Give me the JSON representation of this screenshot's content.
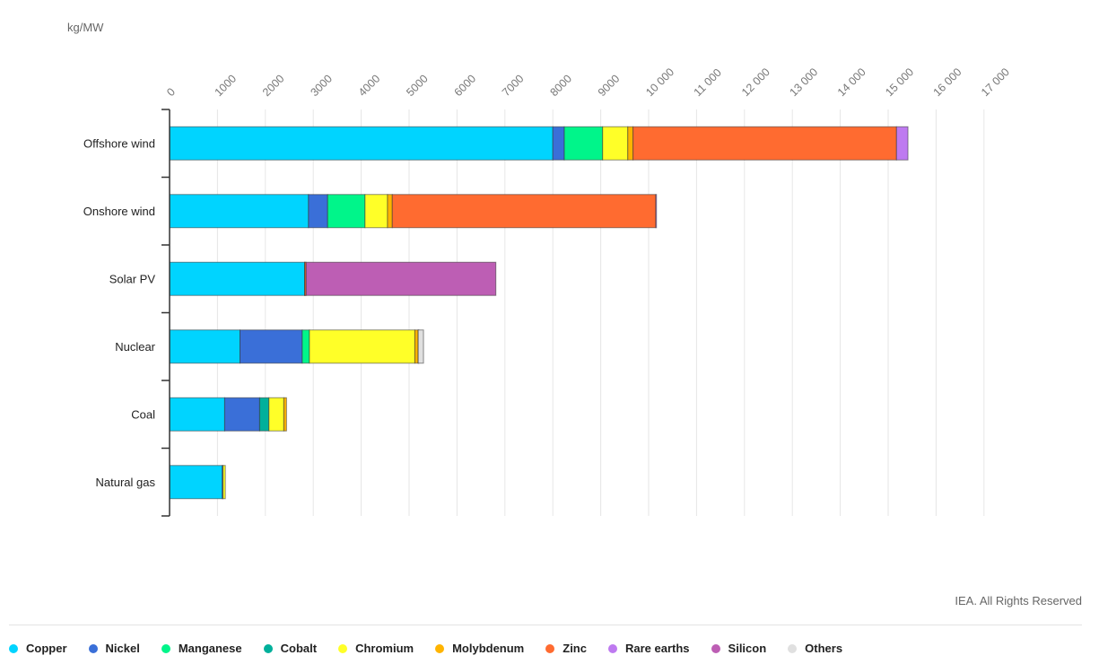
{
  "chart_data": {
    "type": "bar",
    "orientation": "horizontal",
    "stacked": true,
    "title": "",
    "unit_label": "kg/MW",
    "xlabel": "",
    "ylabel": "",
    "xlim": [
      0,
      17000
    ],
    "x_ticks": [
      0,
      1000,
      2000,
      3000,
      4000,
      5000,
      6000,
      7000,
      8000,
      9000,
      10000,
      11000,
      12000,
      13000,
      14000,
      15000,
      16000,
      17000
    ],
    "x_tick_labels": [
      "0",
      "1000",
      "2000",
      "3000",
      "4000",
      "5000",
      "6000",
      "7000",
      "8000",
      "9000",
      "10 000",
      "11 000",
      "12 000",
      "13 000",
      "14 000",
      "15 000",
      "16 000",
      "17 000"
    ],
    "grid": true,
    "legend_position": "bottom",
    "categories": [
      "Offshore wind",
      "Onshore wind",
      "Solar PV",
      "Nuclear",
      "Coal",
      "Natural gas"
    ],
    "series": [
      {
        "name": "Copper",
        "color": "#00d4ff",
        "values": [
          8000,
          2900,
          2820,
          1470,
          1150,
          1100
        ]
      },
      {
        "name": "Nickel",
        "color": "#3a6fd8",
        "values": [
          240,
          400,
          1,
          1300,
          730,
          16
        ]
      },
      {
        "name": "Manganese",
        "color": "#00f58a",
        "values": [
          800,
          780,
          0,
          150,
          0,
          0
        ]
      },
      {
        "name": "Cobalt",
        "color": "#00b09b",
        "values": [
          0,
          0,
          0,
          0,
          195,
          0
        ]
      },
      {
        "name": "Chromium",
        "color": "#ffff28",
        "values": [
          525,
          470,
          0,
          2200,
          310,
          48
        ]
      },
      {
        "name": "Molybdenum",
        "color": "#ffb400",
        "values": [
          109,
          99,
          0,
          70,
          56,
          0
        ]
      },
      {
        "name": "Zinc",
        "color": "#ff6b30",
        "values": [
          5500,
          5500,
          30,
          0,
          0,
          0
        ]
      },
      {
        "name": "Rare earths",
        "color": "#be7af0",
        "values": [
          239,
          14,
          0,
          0.5,
          0,
          0
        ]
      },
      {
        "name": "Silicon",
        "color": "#bd5eb4",
        "values": [
          0,
          0,
          3960,
          0,
          0,
          0
        ]
      },
      {
        "name": "Others",
        "color": "#e0e0e0",
        "values": [
          0,
          0,
          0,
          110,
          0,
          0
        ]
      }
    ]
  },
  "credit": "IEA. All Rights Reserved"
}
